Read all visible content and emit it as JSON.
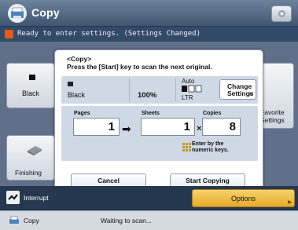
{
  "header": {
    "title": "Copy"
  },
  "status_bar": {
    "message": "Ready to enter settings. (Settings Changed)"
  },
  "background": {
    "color_label": "Black",
    "favorite_label_line1": "Favorite",
    "favorite_label_line2": "Settings",
    "finishing_label": "Finishing"
  },
  "modal": {
    "title": "<Copy>",
    "message": "Press the [Start] key to scan the next original.",
    "color": "Black",
    "zoom": "100%",
    "paper_auto": "Auto",
    "paper_size": "LTR",
    "change_settings_line1": "Change",
    "change_settings_line2": "Settings",
    "pages_label": "Pages",
    "pages_value": "1",
    "sheets_label": "Sheets",
    "sheets_value": "1",
    "copies_label": "Copies",
    "copies_value": "8",
    "numeric_hint_line1": "Enter by the",
    "numeric_hint_line2": "numeric keys.",
    "cancel_label": "Cancel",
    "start_label": "Start Copying"
  },
  "bottom_bar": {
    "interrupt_label": "Interrupt",
    "options_label": "Options"
  },
  "footer": {
    "app_name": "Copy",
    "status": "Waiting to scan..."
  },
  "colors": {
    "header": "#4f6784",
    "options": "#efbd45",
    "alert": "#e45a18"
  }
}
